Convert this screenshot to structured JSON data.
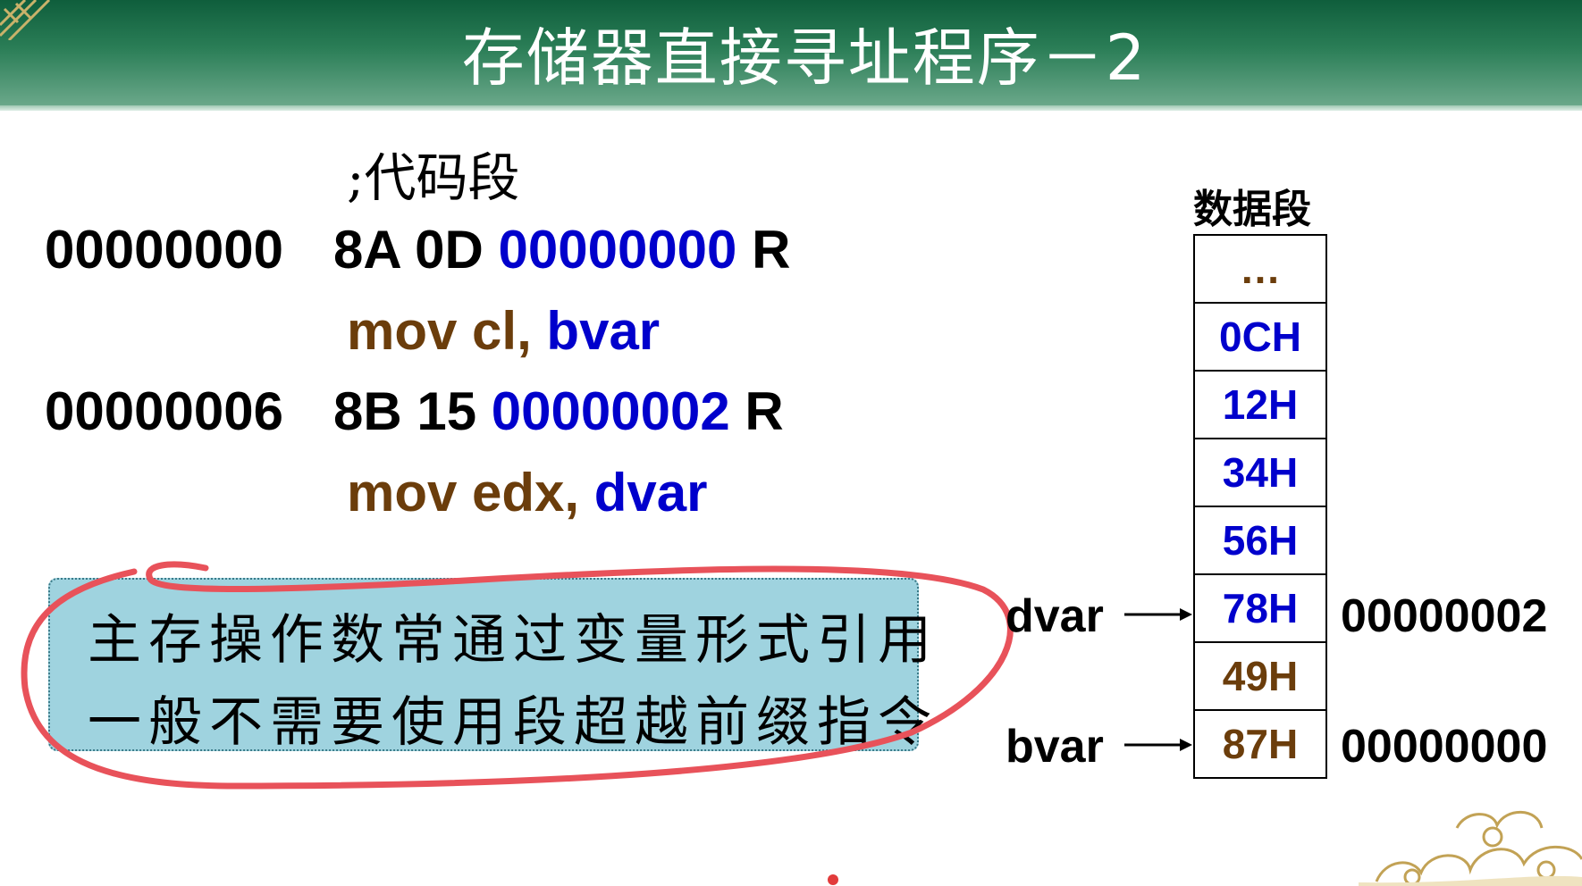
{
  "slide": {
    "title": "存储器直接寻址程序－2"
  },
  "code": {
    "comment": ";代码段",
    "line1": {
      "address": "00000000",
      "bytes": "8A 0D",
      "operand": "00000000",
      "reloc": "R"
    },
    "line2": {
      "mnemonic": "mov cl,",
      "var": "bvar"
    },
    "line3": {
      "address": "00000006",
      "bytes": "8B 15",
      "operand": "00000002",
      "reloc": "R"
    },
    "line4": {
      "mnemonic": "mov edx,",
      "var": "dvar"
    }
  },
  "note": {
    "line1": "主存操作数常通过变量形式引用",
    "line2": "一般不需要使用段超越前缀指令"
  },
  "memory": {
    "title": "数据段",
    "cells": [
      {
        "value": "…",
        "color": "#6b3d0b"
      },
      {
        "value": "0CH",
        "color": "#0000cc"
      },
      {
        "value": "12H",
        "color": "#0000cc"
      },
      {
        "value": "34H",
        "color": "#0000cc"
      },
      {
        "value": "56H",
        "color": "#0000cc"
      },
      {
        "value": "78H",
        "color": "#0000cc"
      },
      {
        "value": "49H",
        "color": "#6b3d0b"
      },
      {
        "value": "87H",
        "color": "#6b3d0b"
      }
    ],
    "pointers": {
      "dvar": {
        "label": "dvar",
        "address": "00000002"
      },
      "bvar": {
        "label": "bvar",
        "address": "00000000"
      }
    }
  },
  "colors": {
    "title_bar": "#1f6e48",
    "keyword_blue": "#0000cc",
    "mnemonic_brown": "#6b3d0b",
    "note_bg": "#9fd3df",
    "annotation_red": "#e8525a"
  }
}
